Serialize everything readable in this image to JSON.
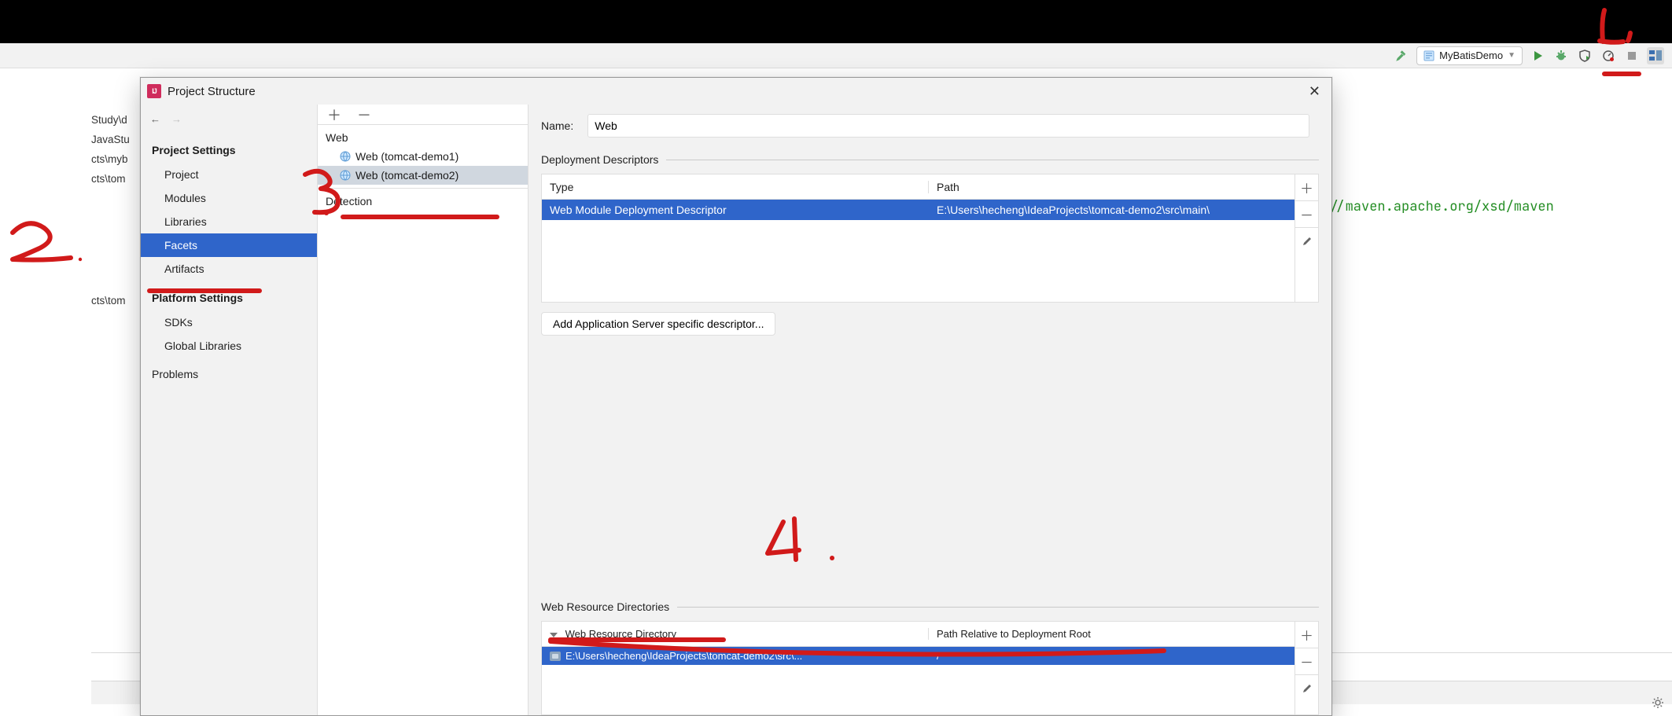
{
  "ide": {
    "run_config_label": "MyBatisDemo",
    "code_fragment": "://maven.apache.org/xsd/maven"
  },
  "background_partials": [
    "Study\\d",
    "JavaStu",
    "cts\\myb",
    "cts\\tom",
    "",
    "cts\\tom"
  ],
  "dialog": {
    "title": "Project Structure",
    "sidebar": {
      "groups": [
        {
          "title": "Project Settings",
          "items": [
            {
              "label": "Project",
              "selected": false
            },
            {
              "label": "Modules",
              "selected": false
            },
            {
              "label": "Libraries",
              "selected": false
            },
            {
              "label": "Facets",
              "selected": true
            },
            {
              "label": "Artifacts",
              "selected": false
            }
          ]
        },
        {
          "title": "Platform Settings",
          "items": [
            {
              "label": "SDKs",
              "selected": false
            },
            {
              "label": "Global Libraries",
              "selected": false
            }
          ]
        }
      ],
      "problems_label": "Problems"
    },
    "facets": {
      "group": "Web",
      "nodes": [
        {
          "label": "Web (tomcat-demo1)",
          "selected": false
        },
        {
          "label": "Web (tomcat-demo2)",
          "selected": true
        }
      ],
      "detection_label": "Detection"
    },
    "editor": {
      "name_label": "Name:",
      "name_value": "Web",
      "dd_section": "Deployment Descriptors",
      "dd_cols": {
        "a": "Type",
        "b": "Path"
      },
      "dd_rows": [
        {
          "a": "Web Module Deployment Descriptor",
          "b": "E:\\Users\\hecheng\\IdeaProjects\\tomcat-demo2\\src\\main\\"
        }
      ],
      "add_descriptor_btn": "Add Application Server specific descriptor...",
      "wr_section": "Web Resource Directories",
      "wr_cols": {
        "a": "Web Resource Directory",
        "b": "Path Relative to Deployment Root"
      },
      "wr_rows": [
        {
          "a": "E:\\Users\\hecheng\\IdeaProjects\\tomcat-demo2\\src\\...",
          "b": "/"
        }
      ]
    }
  },
  "annotations": {
    "n1": "1.",
    "n2": "2.",
    "n3": "3.",
    "n4": "4."
  }
}
